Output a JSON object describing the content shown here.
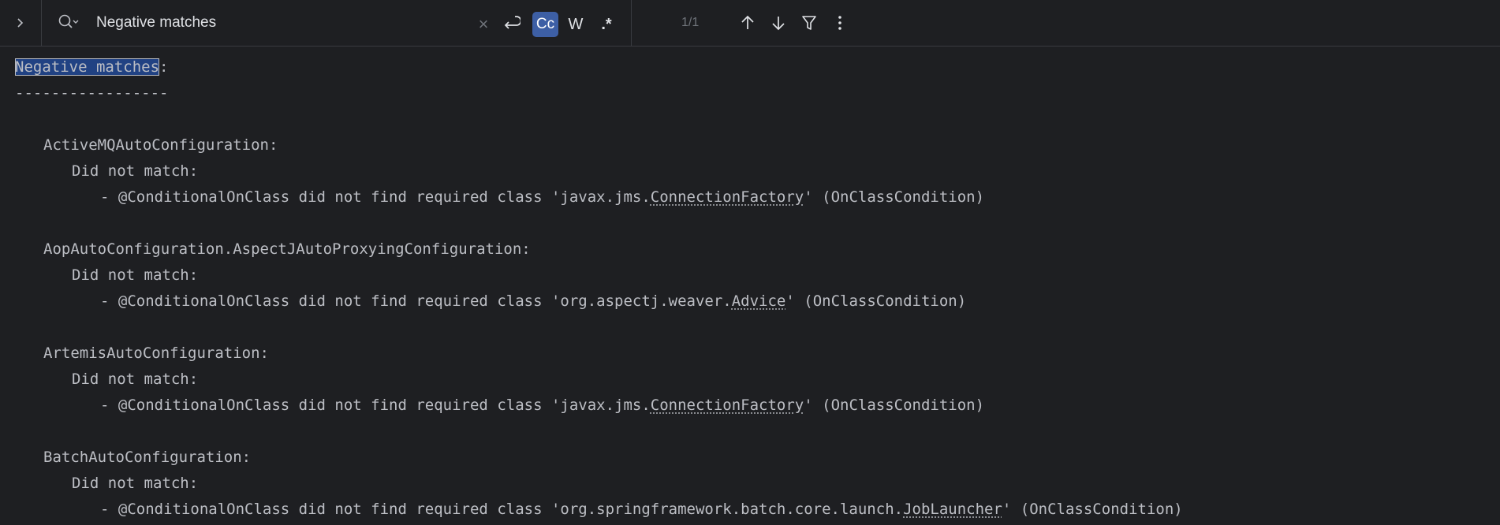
{
  "search": {
    "query": "Negative matches",
    "match_count": "1/1",
    "clear_glyph": "×",
    "case_label": "Cc",
    "words_label": "W",
    "regex_label": ".*"
  },
  "icons": {
    "expand": "chevron-right-icon",
    "search_options": "search-history-icon",
    "clear": "close-icon",
    "newline": "newline-icon",
    "prev": "arrow-up-icon",
    "next": "arrow-down-icon",
    "filter": "filter-icon",
    "more": "more-vertical-icon"
  },
  "colors": {
    "background": "#1e1f22",
    "text": "#bcbec4",
    "active_toggle": "#3d5fa5",
    "match_highlight": "#214283"
  },
  "console": {
    "heading": "Negative matches",
    "heading_colon": ":",
    "rule": "-----------------",
    "entries": [
      {
        "name": "ActiveMQAutoConfiguration:",
        "status": "Did not match:",
        "prefix": "- @ConditionalOnClass did not find required class 'javax.jms.",
        "class": "ConnectionFactory",
        "suffix": "' (OnClassCondition)"
      },
      {
        "name": "AopAutoConfiguration.AspectJAutoProxyingConfiguration:",
        "status": "Did not match:",
        "prefix": "- @ConditionalOnClass did not find required class 'org.aspectj.weaver.",
        "class": "Advice",
        "suffix": "' (OnClassCondition)"
      },
      {
        "name": "ArtemisAutoConfiguration:",
        "status": "Did not match:",
        "prefix": "- @ConditionalOnClass did not find required class 'javax.jms.",
        "class": "ConnectionFactory",
        "suffix": "' (OnClassCondition)"
      },
      {
        "name": "BatchAutoConfiguration:",
        "status": "Did not match:",
        "prefix": "- @ConditionalOnClass did not find required class 'org.springframework.batch.core.launch.",
        "class": "JobLauncher",
        "suffix": "' (OnClassCondition)"
      }
    ]
  }
}
